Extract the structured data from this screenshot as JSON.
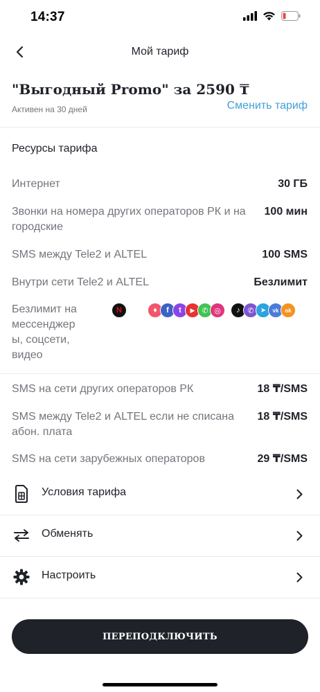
{
  "status_bar": {
    "time": "14:37",
    "battery_color": "#e84a4a"
  },
  "nav": {
    "title": "Мой тариф",
    "back_icon": "chevron-left-icon"
  },
  "tariff": {
    "name": "\"Выгодный Promo\" за 2590 ₸",
    "active": "Активен на 30 дней",
    "change_label": "Сменить тариф",
    "accent_color": "#3fa1d6"
  },
  "resources": {
    "title": "Ресурсы тарифа",
    "items": [
      {
        "label": "Интернет",
        "value": "30 ГБ"
      },
      {
        "label": "Звонки на номера других операторов РК и на городские",
        "value": "100 мин"
      },
      {
        "label": "SMS между Tele2 и ALTEL",
        "value": "100 SMS"
      },
      {
        "label": "Внутри сети Tele2 и ALTEL",
        "value": "Безлимит"
      }
    ],
    "apps_label": "Безлимит на мессенджер ы, соцсети, видео",
    "apps": [
      {
        "name": "netflix-icon",
        "glyph": "N",
        "color": "#111111"
      },
      {
        "name": "tinder-icon",
        "glyph": "♦",
        "color": "#f2546b"
      },
      {
        "name": "facebook-icon",
        "glyph": "f",
        "color": "#3b62c4"
      },
      {
        "name": "twitch-icon",
        "glyph": "t",
        "color": "#8a45e8"
      },
      {
        "name": "youtube-icon",
        "glyph": "▶",
        "color": "#e8322f"
      },
      {
        "name": "whatsapp-icon",
        "glyph": "✆",
        "color": "#3fc452"
      },
      {
        "name": "instagram-icon",
        "glyph": "◎",
        "color": "#e0357a"
      },
      {
        "name": "tiktok-icon",
        "glyph": "♪",
        "color": "#111111"
      },
      {
        "name": "viber-icon",
        "glyph": "✆",
        "color": "#7e55cf"
      },
      {
        "name": "telegram-icon",
        "glyph": "➤",
        "color": "#2aa3df"
      },
      {
        "name": "vk-icon",
        "glyph": "vk",
        "color": "#4c7bd9"
      },
      {
        "name": "odnoklassniki-icon",
        "glyph": "ok",
        "color": "#f39320"
      }
    ]
  },
  "charges": [
    {
      "label": "SMS на сети других операторов РК",
      "value": "18 ₸/SMS"
    },
    {
      "label": "SMS между Tele2 и ALTEL если не списана абон. плата",
      "value": "18 ₸/SMS"
    },
    {
      "label": "SMS на сети зарубежных операторов",
      "value": "29 ₸/SMS"
    }
  ],
  "menu": [
    {
      "label": "Условия тарифа",
      "icon": "sim-card-icon"
    },
    {
      "label": "Обменять",
      "icon": "exchange-arrows-icon"
    },
    {
      "label": "Настроить",
      "icon": "gear-icon"
    }
  ],
  "reconnect_label": "ПЕРЕПОДКЛЮЧИТЬ"
}
